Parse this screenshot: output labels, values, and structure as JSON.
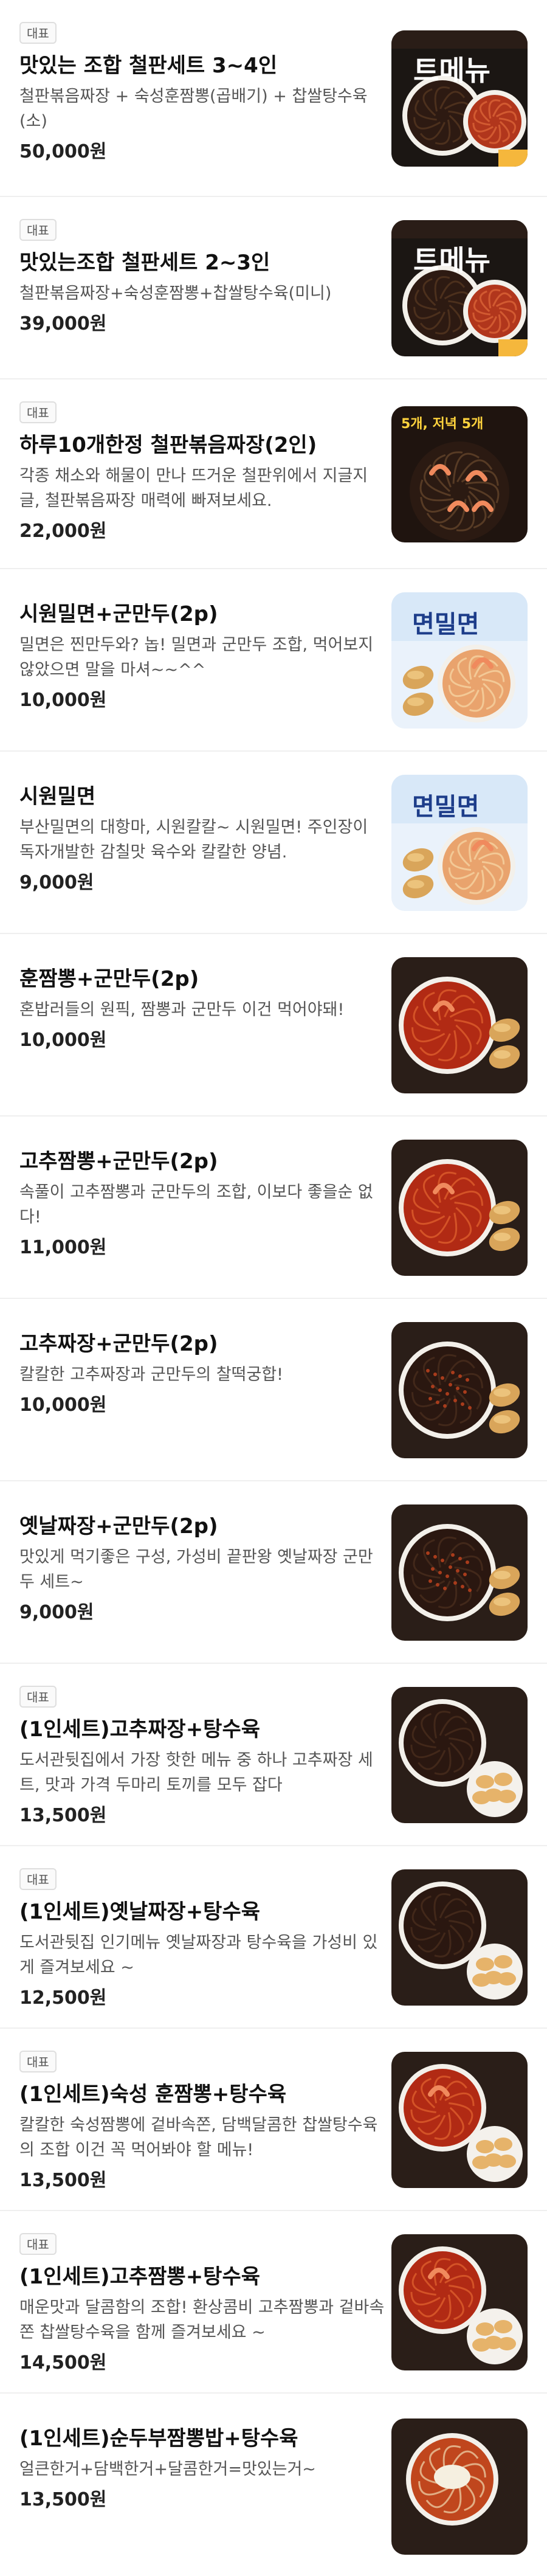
{
  "menu": {
    "items": [
      {
        "badge": "대표",
        "name": "맛있는 조합 철판세트 3~4인",
        "description": "철판볶음짜장 + 숙성훈짬뽕(곱배기) + 찹쌀탕수육(소)",
        "price": "50,000원",
        "image_text": "트메뉴",
        "image": "set-poster"
      },
      {
        "badge": "대표",
        "name": "맛있는조합 철판세트 2~3인",
        "description": "철판볶음짜장+숙성훈짬뽕+찹쌀탕수육(미니)",
        "price": "39,000원",
        "image_text": "트메뉴",
        "image": "set-poster"
      },
      {
        "badge": "대표",
        "name": "하루10개한정 철판볶음짜장(2인)",
        "description": "각종 채소와 해물이 만나 뜨거운 철판위에서 지글지글, 철판볶음짜장 매력에 빠져보세요.",
        "price": "22,000원",
        "image_text": "5개, 저녁 5개",
        "image": "iron-plate"
      },
      {
        "badge": "",
        "name": "시원밀면+군만두(2p)",
        "description": "밀면은 찐만두와? 놉! 밀면과 군만두 조합, 먹어보지 않았으면 말을 마셔~~^^",
        "price": "10,000원",
        "image_text": "면밀면",
        "image": "milmyeon-poster"
      },
      {
        "badge": "",
        "name": "시원밀면",
        "description": "부산밀면의 대항마, 시원칼칼~ 시원밀면! 주인장이 독자개발한 감칠맛 육수와 칼칼한 양념.",
        "price": "9,000원",
        "image_text": "면밀면",
        "image": "milmyeon-poster"
      },
      {
        "badge": "",
        "name": "훈짬뽕+군만두(2p)",
        "description": "혼밥러들의 원픽, 짬뽕과 군만두 이건 먹어야돼!",
        "price": "10,000원",
        "image_text": "",
        "image": "jjamppong-dumpling"
      },
      {
        "badge": "",
        "name": "고추짬뽕+군만두(2p)",
        "description": "속풀이 고추짬뽕과 군만두의 조합, 이보다 좋을순 없다!",
        "price": "11,000원",
        "image_text": "",
        "image": "jjamppong-dumpling"
      },
      {
        "badge": "",
        "name": "고추짜장+군만두(2p)",
        "description": "칼칼한 고추짜장과 군만두의 찰떡궁합!",
        "price": "10,000원",
        "image_text": "",
        "image": "jjajang-dumpling"
      },
      {
        "badge": "",
        "name": "옛날짜장+군만두(2p)",
        "description": "맛있게 먹기좋은 구성, 가성비 끝판왕 옛날짜장 군만두 세트~",
        "price": "9,000원",
        "image_text": "",
        "image": "jjajang-dumpling"
      },
      {
        "badge": "대표",
        "name": "(1인세트)고추짜장+탕수육",
        "description": "도서관뒷집에서 가장 핫한 메뉴 중 하나 고추짜장 세트, 맛과 가격 두마리 토끼를 모두 잡다",
        "price": "13,500원",
        "image_text": "",
        "image": "jjajang-tangsuyuk"
      },
      {
        "badge": "대표",
        "name": "(1인세트)옛날짜장+탕수육",
        "description": "도서관뒷집 인기메뉴 옛날짜장과 탕수육을 가성비 있게 즐겨보세요 ~",
        "price": "12,500원",
        "image_text": "",
        "image": "jjajang-tangsuyuk"
      },
      {
        "badge": "대표",
        "name": "(1인세트)숙성 훈짬뽕+탕수육",
        "description": "칼칼한 숙성짬뽕에 겉바속쫀, 담백달콤한 찹쌀탕수육의 조합 이건 꼭 먹어봐야 할 메뉴!",
        "price": "13,500원",
        "image_text": "",
        "image": "jjamppong-tangsuyuk"
      },
      {
        "badge": "대표",
        "name": "(1인세트)고추짬뽕+탕수육",
        "description": "매운맛과 달콤함의 조합! 환상콤비 고추짬뽕과 겉바속쫀 찹쌀탕수육을 함께 즐겨보세요 ~",
        "price": "14,500원",
        "image_text": "",
        "image": "jjamppong-tangsuyuk"
      },
      {
        "badge": "",
        "name": "(1인세트)순두부짬뽕밥+탕수육",
        "description": "얼큰한거+담백한거+달콤한거=맛있는거~",
        "price": "13,500원",
        "image_text": "",
        "image": "soondubu-tangsuyuk"
      }
    ]
  },
  "colors": {
    "badge_border": "#dedede",
    "name": "#111111",
    "description": "#555555",
    "price": "#222222",
    "divider": "#efefef"
  }
}
